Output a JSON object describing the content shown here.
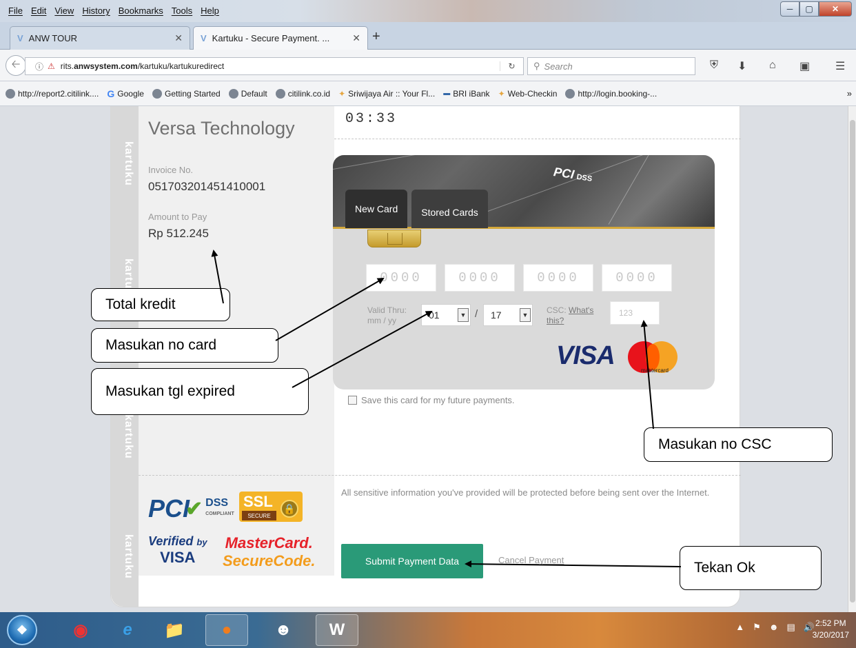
{
  "browser": {
    "menu": [
      "File",
      "Edit",
      "View",
      "History",
      "Bookmarks",
      "Tools",
      "Help"
    ],
    "tabs": [
      {
        "title": "ANW TOUR"
      },
      {
        "title": "Kartuku - Secure Payment. ..."
      }
    ],
    "url_prefix": "rits.",
    "url_domain": "anwsystem.com",
    "url_path": "/kartuku/kartukuredirect",
    "search_placeholder": "Search",
    "bookmarks": [
      "http://report2.citilink....",
      "Google",
      "Getting Started",
      "Default",
      "citilink.co.id",
      "Sriwijaya Air :: Your Fl...",
      "BRI iBank",
      "Web-Checkin",
      "http://login.booking-..."
    ]
  },
  "brand": {
    "strip_text": "kartuku"
  },
  "payment": {
    "timer": "03:33",
    "merchant": "Versa Technology",
    "invoice_label": "Invoice No.",
    "invoice_no": "051703201451410001",
    "amount_label": "Amount to Pay",
    "amount": "Rp 512.245",
    "tabs": {
      "new": "New Card",
      "stored": "Stored Cards"
    },
    "pci_text": "PCI",
    "pci_sub": "DSS",
    "card_placeholders": [
      "0000",
      "0000",
      "0000",
      "0000"
    ],
    "valid_label": "Valid Thru:",
    "valid_format": "mm / yy",
    "month": "01",
    "year": "17",
    "csc_label": "CSC:",
    "csc_link_1": "What's",
    "csc_link_2": "this?",
    "csc_placeholder": "123",
    "visa": "VISA",
    "mastercard": "mastercard",
    "save_card": "Save this card for my future payments.",
    "security_text": "All sensitive information you've provided will be protected before being sent over the Internet.",
    "submit": "Submit Payment Data",
    "cancel": "Cancel Payment"
  },
  "security_logos": {
    "pci": "PCI",
    "dss": "DSS",
    "dss_sub": "COMPLIANT",
    "ssl": "SSL",
    "ssl_sub": "SECURE",
    "vbv_1": "Verified",
    "vbv_by": "by",
    "vbv_2": "VISA",
    "mc_1": "MasterCard.",
    "mc_2": "SecureCode."
  },
  "annotations": {
    "total_kredit": "Total kredit",
    "no_card": "Masukan no card",
    "tgl_expired": "Masukan tgl expired",
    "no_csc": "Masukan no CSC",
    "tekan_ok": "Tekan Ok"
  },
  "taskbar": {
    "time": "2:52 PM",
    "date": "3/20/2017"
  }
}
